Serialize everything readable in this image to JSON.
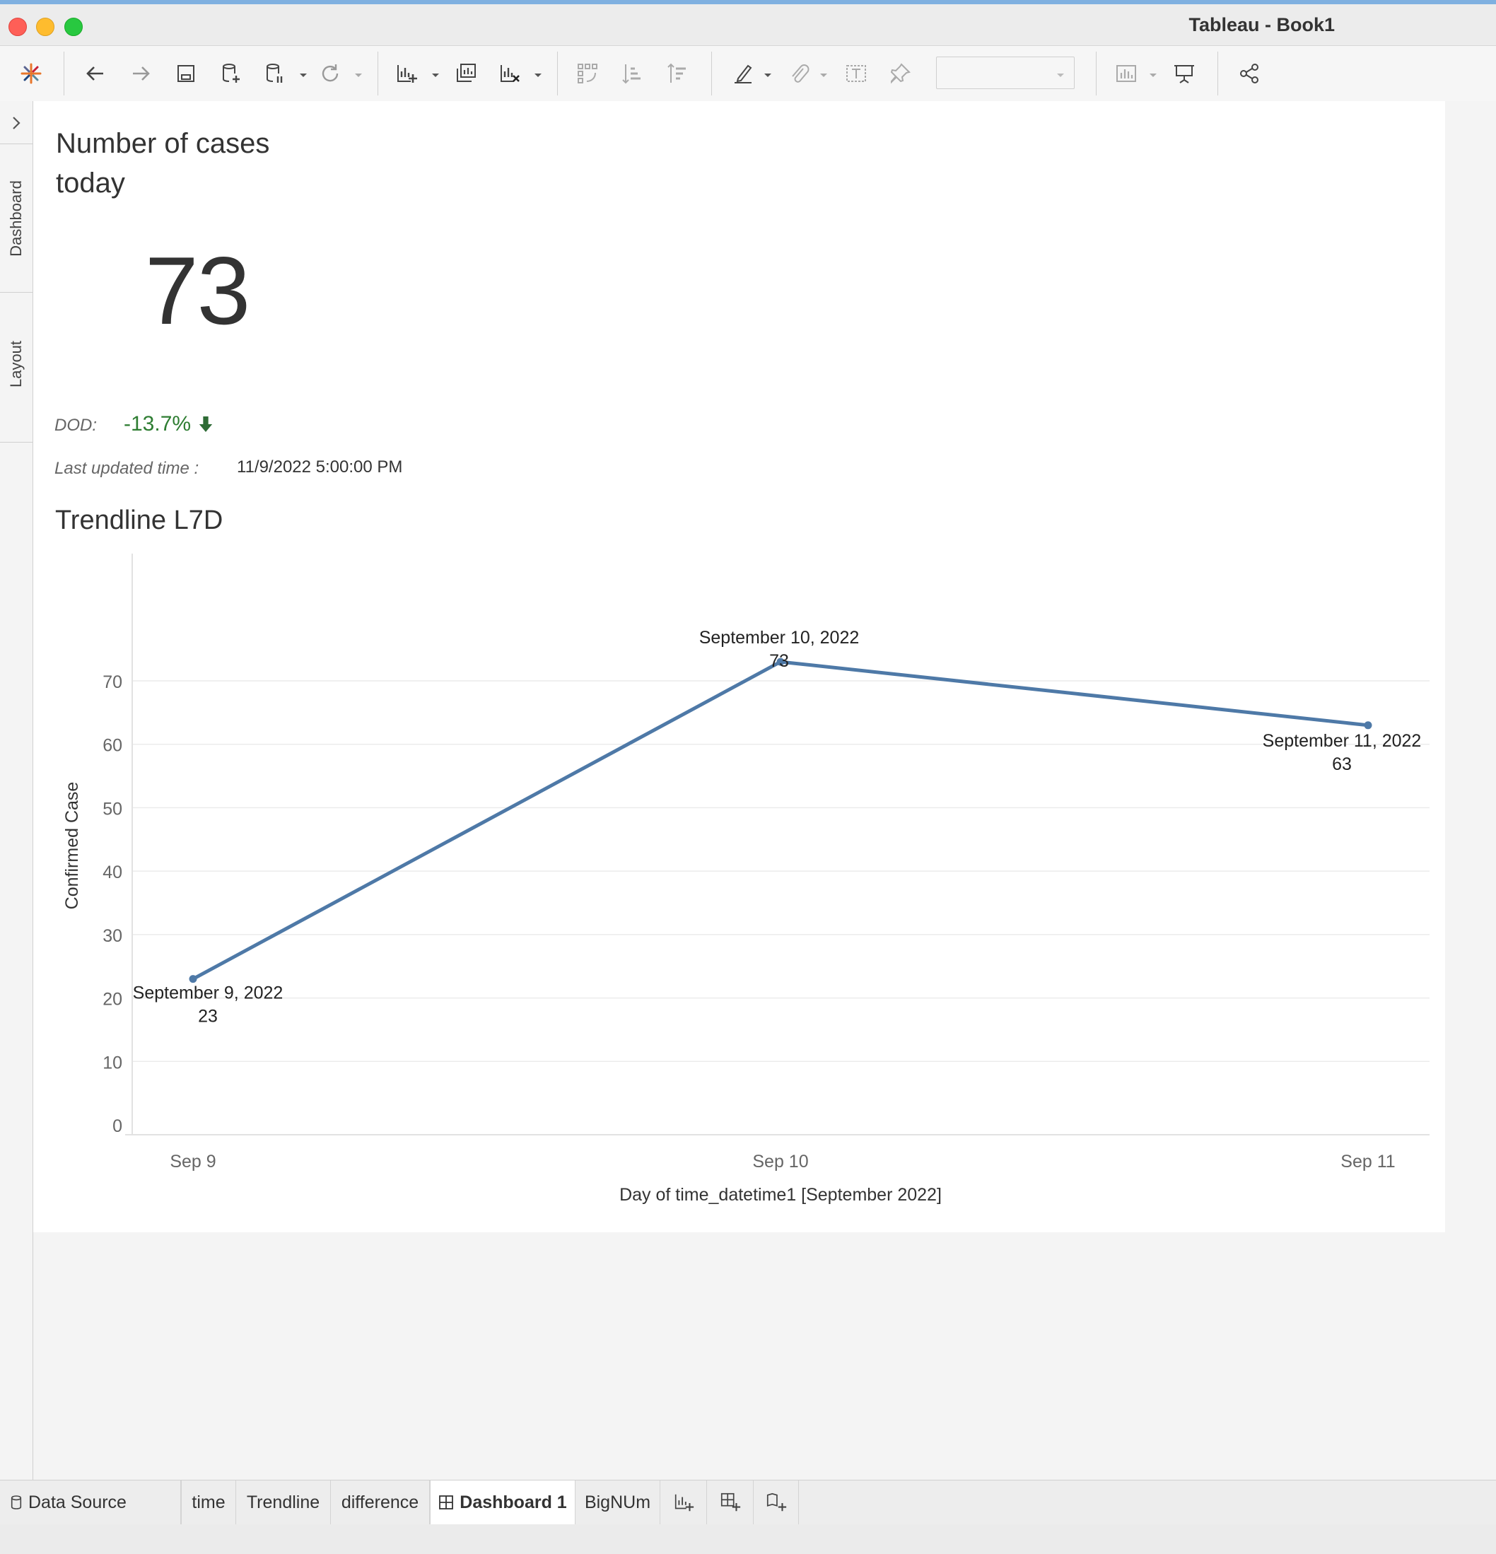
{
  "window": {
    "title": "Tableau - Book1"
  },
  "sidebar": {
    "tabs": [
      "Dashboard",
      "Layout"
    ]
  },
  "kpi": {
    "title": "Number of cases today",
    "value": "73",
    "dod_label": "DOD:",
    "dod_value": "-13.7%",
    "updated_label": "Last updated time :",
    "updated_value": "11/9/2022 5:00:00 PM"
  },
  "trend": {
    "title": "Trendline L7D"
  },
  "chart_data": {
    "type": "line",
    "x": [
      "Sep 9",
      "Sep 10",
      "Sep 11"
    ],
    "point_labels": [
      "September 9, 2022",
      "September 10, 2022",
      "September 11, 2022"
    ],
    "series": [
      {
        "values": [
          23,
          73,
          63
        ]
      }
    ],
    "xlabel": "Day of time_datetime1 [September 2022]",
    "ylabel": "Confirmed Case",
    "yticks": [
      0,
      10,
      20,
      30,
      40,
      50,
      60,
      70
    ],
    "ylim": [
      0,
      76
    ],
    "grid": true,
    "line_color": "#4e79a7"
  },
  "sheet_tabs": [
    "Data Source",
    "time",
    "Trendline",
    "difference",
    "Dashboard 1",
    "BigNUm"
  ],
  "active_tab": "Dashboard 1"
}
